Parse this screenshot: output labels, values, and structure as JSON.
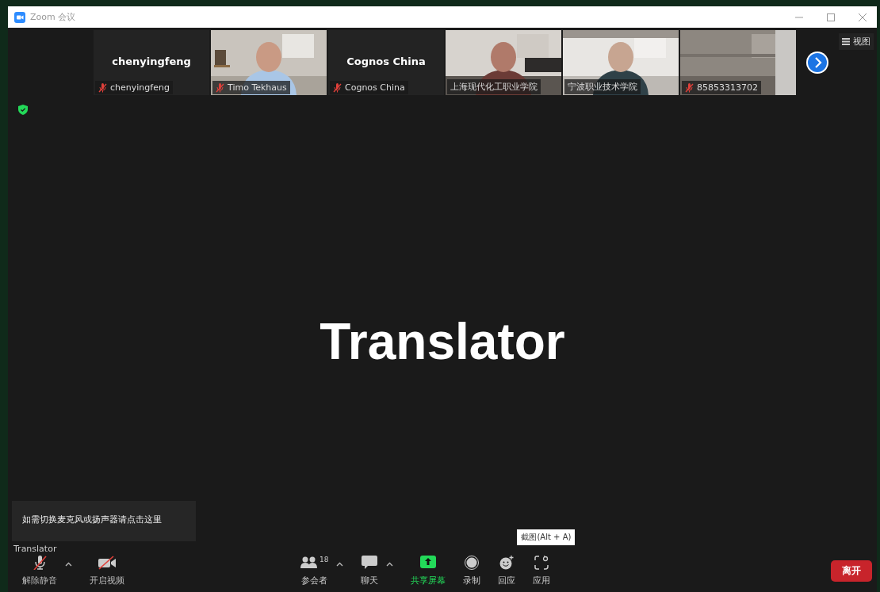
{
  "window": {
    "title": "Zoom 会议"
  },
  "participants": [
    {
      "kind": "name",
      "display_name": "chenyingfeng",
      "label": "chenyingfeng",
      "muted": true
    },
    {
      "kind": "video",
      "label": "Timo Tekhaus",
      "muted": true
    },
    {
      "kind": "name",
      "display_name": "Cognos China",
      "label": "Cognos China",
      "muted": true
    },
    {
      "kind": "video",
      "label": "上海现代化工职业学院",
      "muted": false
    },
    {
      "kind": "video",
      "label": "宁波职业技术学院",
      "muted": false
    },
    {
      "kind": "video",
      "label": "85853313702",
      "muted": true
    }
  ],
  "view_button": {
    "label": "视图"
  },
  "stage": {
    "speaker": "Translator"
  },
  "audio_tip": {
    "text": "如需切换麦克风或扬声器请点击这里"
  },
  "speaker_label": "Translator",
  "toolbar": [
    {
      "kind": "mic",
      "label": "解除静音",
      "menu": true,
      "off": true
    },
    {
      "kind": "video",
      "label": "开启视频",
      "menu": false,
      "off": true
    },
    {
      "kind": "participants",
      "label": "参会者",
      "badge": "18",
      "menu": true,
      "off": false
    },
    {
      "kind": "chat",
      "label": "聊天",
      "menu": true,
      "off": false
    },
    {
      "kind": "share",
      "label": "共享屏幕",
      "menu": false,
      "off": false
    },
    {
      "kind": "record",
      "label": "录制",
      "menu": false,
      "off": false
    },
    {
      "kind": "reactions",
      "label": "回应",
      "menu": false,
      "off": false
    },
    {
      "kind": "apps",
      "label": "应用",
      "menu": false,
      "off": false,
      "hint": "截图(Alt + A)"
    }
  ],
  "leave_button": {
    "label": "离开"
  }
}
